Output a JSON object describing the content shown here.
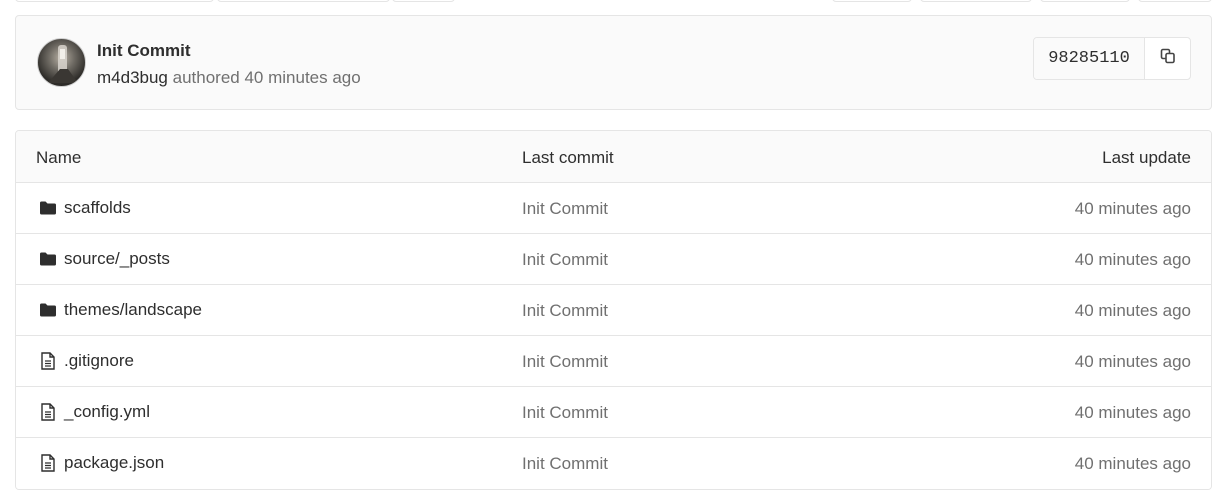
{
  "commit": {
    "title": "Init Commit",
    "author": "m4d3bug",
    "authored_text": "authored 40 minutes ago",
    "sha": "98285110",
    "copy_icon": "copy-icon"
  },
  "table": {
    "headers": {
      "name": "Name",
      "last_commit": "Last commit",
      "last_update": "Last update"
    },
    "rows": [
      {
        "type": "folder",
        "name": "scaffolds",
        "last_commit": "Init Commit",
        "last_update": "40 minutes ago"
      },
      {
        "type": "folder",
        "name": "source/_posts",
        "last_commit": "Init Commit",
        "last_update": "40 minutes ago"
      },
      {
        "type": "folder",
        "name": "themes/landscape",
        "last_commit": "Init Commit",
        "last_update": "40 minutes ago"
      },
      {
        "type": "file",
        "name": ".gitignore",
        "last_commit": "Init Commit",
        "last_update": "40 minutes ago"
      },
      {
        "type": "file",
        "name": "_config.yml",
        "last_commit": "Init Commit",
        "last_update": "40 minutes ago"
      },
      {
        "type": "file",
        "name": "package.json",
        "last_commit": "Init Commit",
        "last_update": "40 minutes ago"
      }
    ]
  },
  "icons": {
    "folder": "folder-icon",
    "file": "file-icon"
  },
  "colors": {
    "text": "#2e2e2e",
    "muted": "#707070",
    "border": "#e5e5e5",
    "panel_bg": "#fafafa"
  }
}
